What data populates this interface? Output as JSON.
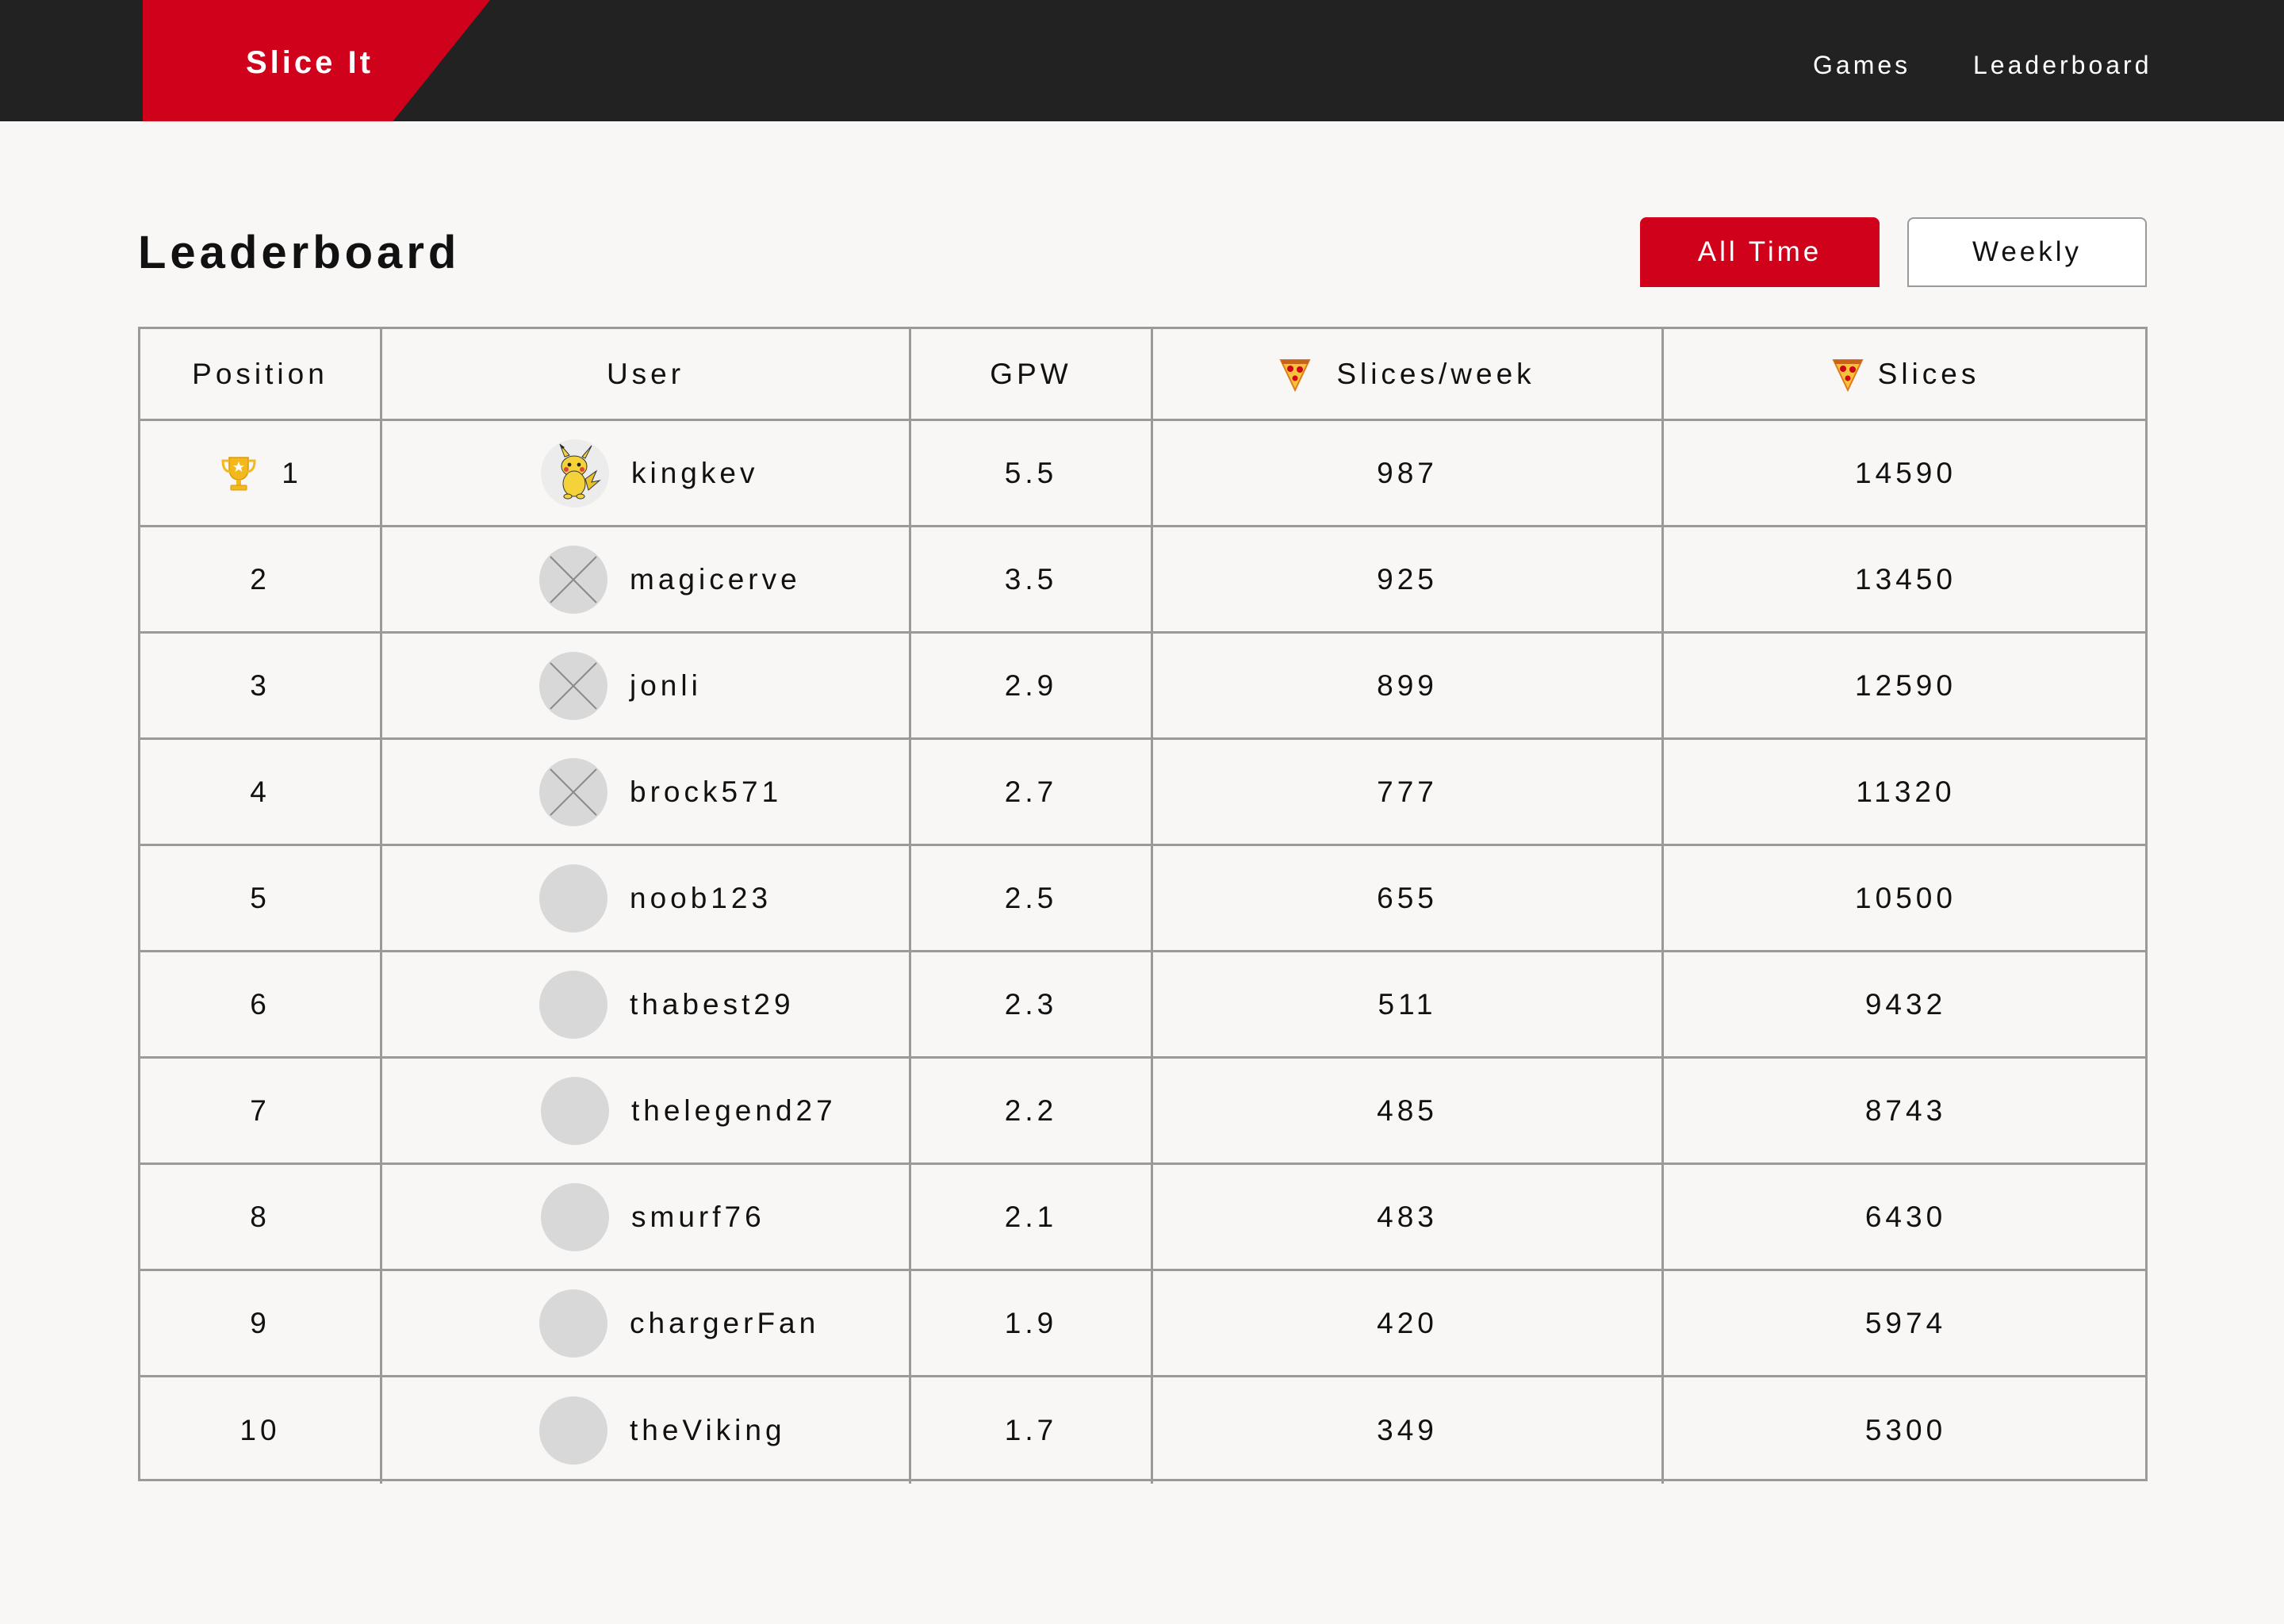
{
  "app": {
    "brand": "Slice It"
  },
  "nav": {
    "games": "Games",
    "leaderboard": "Leaderboard"
  },
  "page": {
    "title": "Leaderboard"
  },
  "toggles": {
    "all_time": "All Time",
    "weekly": "Weekly",
    "selected": "All Time"
  },
  "colors": {
    "accent": "#d0021b",
    "topbar": "#222222",
    "background": "#f8f7f6",
    "border": "#9a9a9a"
  },
  "table": {
    "headers": {
      "position": "Position",
      "user": "User",
      "gpw": "GPW",
      "slices_week": "Slices/week",
      "slices": "Slices"
    },
    "rows": [
      {
        "position": "1",
        "user": "kingkev",
        "gpw": "5.5",
        "slices_week": "987",
        "slices": "14590",
        "avatar": "pikachu-avatar",
        "trophy": true
      },
      {
        "position": "2",
        "user": "magicerve",
        "gpw": "3.5",
        "slices_week": "925",
        "slices": "13450",
        "avatar": "placeholder-x"
      },
      {
        "position": "3",
        "user": "jonli",
        "gpw": "2.9",
        "slices_week": "899",
        "slices": "12590",
        "avatar": "placeholder-x"
      },
      {
        "position": "4",
        "user": "brock571",
        "gpw": "2.7",
        "slices_week": "777",
        "slices": "11320",
        "avatar": "placeholder-x"
      },
      {
        "position": "5",
        "user": "noob123",
        "gpw": "2.5",
        "slices_week": "655",
        "slices": "10500",
        "avatar": "blank"
      },
      {
        "position": "6",
        "user": "thabest29",
        "gpw": "2.3",
        "slices_week": "511",
        "slices": "9432",
        "avatar": "blank"
      },
      {
        "position": "7",
        "user": "thelegend27",
        "gpw": "2.2",
        "slices_week": "485",
        "slices": "8743",
        "avatar": "blank"
      },
      {
        "position": "8",
        "user": "smurf76",
        "gpw": "2.1",
        "slices_week": "483",
        "slices": "6430",
        "avatar": "blank"
      },
      {
        "position": "9",
        "user": "chargerFan",
        "gpw": "1.9",
        "slices_week": "420",
        "slices": "5974",
        "avatar": "blank"
      },
      {
        "position": "10",
        "user": "theViking",
        "gpw": "1.7",
        "slices_week": "349",
        "slices": "5300",
        "avatar": "blank"
      }
    ]
  }
}
